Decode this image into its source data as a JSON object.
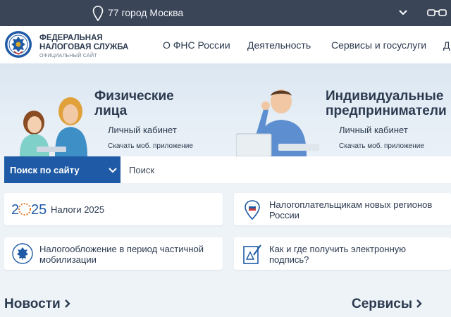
{
  "topbar": {
    "region": "77 город Москва",
    "icons": [
      "location-pin-icon",
      "chevron-down-icon",
      "glasses-icon"
    ]
  },
  "logo": {
    "line1": "ФЕДЕРАЛЬНАЯ",
    "line2": "НАЛОГОВАЯ СЛУЖБА",
    "line3": "ОФИЦИАЛЬНЫЙ САЙТ"
  },
  "nav": [
    {
      "label": "О ФНС России"
    },
    {
      "label": "Деятельность"
    },
    {
      "label": "Сервисы и госуслуги"
    },
    {
      "label": "Д"
    }
  ],
  "hero": {
    "individuals": {
      "title_1": "Физические",
      "title_2": "лица",
      "cabinet": "Личный кабинет",
      "app": "Скачать моб. приложение"
    },
    "entrepreneurs": {
      "title_1": "Индивидуальные",
      "title_2": "предприниматели",
      "cabinet": "Личный кабинет",
      "app": "Скачать моб. приложение"
    }
  },
  "search": {
    "scope_label": "Поиск по сайту",
    "placeholder": "Поиск"
  },
  "cards": {
    "taxes": {
      "logo_text": "2025",
      "label": "Налоги 2025"
    },
    "new_regions": {
      "line1": "Налогоплательщикам новых регионов",
      "line2": "России"
    },
    "mobilization": {
      "line1": "Налогообложение в период частичной",
      "line2": "мобилизации"
    },
    "signature": {
      "line1": "Как и где получить электронную",
      "line2": "подпись?"
    }
  },
  "sections": {
    "news": "Новости",
    "services": "Сервисы"
  },
  "colors": {
    "topbar": "#3a4557",
    "accent_blue": "#1f5aa6",
    "background": "#eef3f8",
    "text": "#2b3a4f"
  }
}
